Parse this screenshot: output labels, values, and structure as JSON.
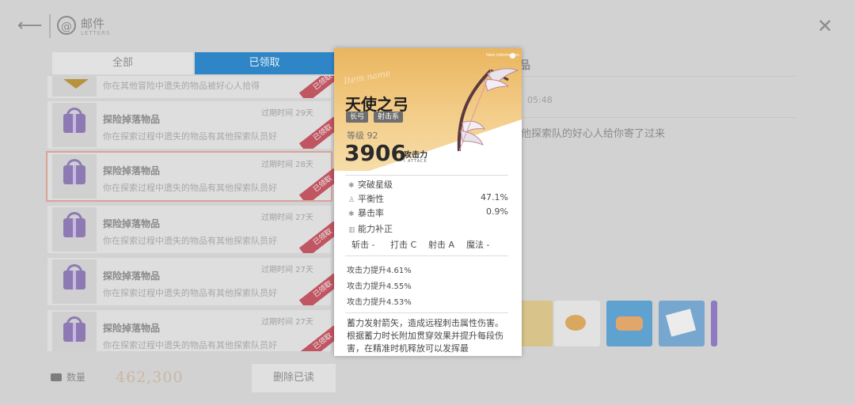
{
  "header": {
    "title": "邮件",
    "subtitle": "LETTERS"
  },
  "tabs": [
    {
      "label": "全部",
      "active": false
    },
    {
      "label": "已领取",
      "active": true
    }
  ],
  "mail_list": [
    {
      "title": "",
      "expire": "",
      "desc": "你在其他冒险中遗失的物品被好心人拾得",
      "stamp": "已领取",
      "partial": true
    },
    {
      "title": "探险掉落物品",
      "expire": "过期时间 29天",
      "desc": "你在探索过程中遗失的物品有其他探索队员好",
      "stamp": "已领取"
    },
    {
      "title": "探险掉落物品",
      "expire": "过期时间 28天",
      "desc": "你在探索过程中遗失的物品有其他探索队员好",
      "stamp": "已领取",
      "selected": true
    },
    {
      "title": "探险掉落物品",
      "expire": "过期时间 27天",
      "desc": "你在探索过程中遗失的物品有其他探索队员好",
      "stamp": "已领取"
    },
    {
      "title": "探险掉落物品",
      "expire": "过期时间 27天",
      "desc": "你在探索过程中遗失的物品有其他探索队员好",
      "stamp": "已领取"
    },
    {
      "title": "探险掉落物品",
      "expire": "过期时间 27天",
      "desc": "你在探索过程中遗失的物品有其他探索队员好",
      "stamp": "已领取"
    }
  ],
  "footer": {
    "capacity_label": "数量",
    "currency": "462,300",
    "delete_label": "删除已读"
  },
  "detail": {
    "title_fragment": "品",
    "date": "05:48",
    "body": "他探索队的好心人给你寄了过来"
  },
  "card": {
    "brand": "Item information",
    "script_title": "Item name",
    "name": "天使之弓",
    "tags": [
      "长弓",
      "射击系"
    ],
    "level": "等级 92",
    "attack": "3906",
    "attack_label": "攻击力",
    "attack_sub": "I ATTACK",
    "stats": [
      {
        "icon": "✱",
        "label": "突破星级",
        "value": ""
      },
      {
        "icon": "♙",
        "label": "平衡性",
        "value": "47.1%"
      },
      {
        "icon": "✱",
        "label": "暴击率",
        "value": "0.9%"
      },
      {
        "icon": "▥",
        "label": "能力补正",
        "value": ""
      }
    ],
    "corrections": [
      "斩击 -",
      "打击 C",
      "射击 A",
      "魔法 -"
    ],
    "bonuses": [
      "攻击力提升4.61%",
      "攻击力提升4.55%",
      "攻击力提升4.53%"
    ],
    "description": "蓄力发射箭矢，造成远程刺击属性伤害。根据蓄力时长附加贯穿效果并提升每段伤害，在精准时机释放可以发挥最"
  },
  "colors": {
    "accent_tab": "#2f86c6",
    "stamp_red": "#c05662",
    "card_gold": "#eab65f"
  }
}
